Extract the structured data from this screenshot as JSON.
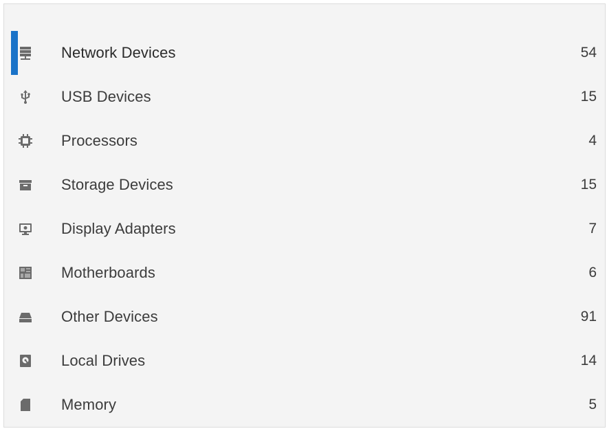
{
  "device_list": {
    "items": [
      {
        "label": "Network Devices",
        "count": "54",
        "icon": "network-server-icon",
        "selected": true
      },
      {
        "label": "USB Devices",
        "count": "15",
        "icon": "usb-icon",
        "selected": false
      },
      {
        "label": "Processors",
        "count": "4",
        "icon": "cpu-chip-icon",
        "selected": false
      },
      {
        "label": "Storage Devices",
        "count": "15",
        "icon": "storage-box-icon",
        "selected": false
      },
      {
        "label": "Display Adapters",
        "count": "7",
        "icon": "monitor-icon",
        "selected": false
      },
      {
        "label": "Motherboards",
        "count": "6",
        "icon": "motherboard-icon",
        "selected": false
      },
      {
        "label": "Other Devices",
        "count": "91",
        "icon": "drive-icon",
        "selected": false
      },
      {
        "label": "Local Drives",
        "count": "14",
        "icon": "hard-disk-icon",
        "selected": false
      },
      {
        "label": "Memory",
        "count": "5",
        "icon": "memory-card-icon",
        "selected": false
      }
    ]
  },
  "colors": {
    "panel_background": "#f4f4f4",
    "selection_accent": "#1a73c8",
    "text": "#3c3c3c",
    "icon": "#6b6b6b"
  }
}
